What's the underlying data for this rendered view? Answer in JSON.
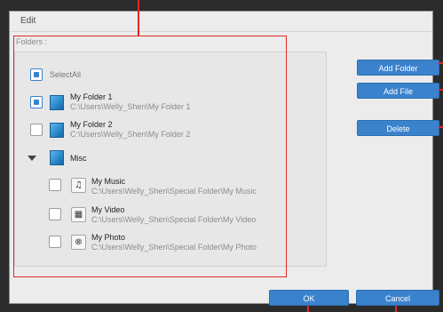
{
  "dialog": {
    "title": "Edit"
  },
  "folders": {
    "label": "Folders :",
    "select_all": {
      "label": "SelectAll",
      "checked": true
    },
    "items": [
      {
        "name": "My Folder 1",
        "path": "C:\\Users\\Welly_Shen\\My Folder 1",
        "checked": true,
        "icon": "folder-icon"
      },
      {
        "name": "My Folder 2",
        "path": "C:\\Users\\Welly_Shen\\My Folder 2",
        "checked": false,
        "icon": "folder-icon"
      }
    ],
    "misc": {
      "name": "Misc",
      "icon": "folder-icon",
      "expanded": true,
      "children": [
        {
          "name": "My Music",
          "path": "C:\\Users\\Welly_Shen\\Special Folder\\My Music",
          "checked": false,
          "icon": "music-icon",
          "glyph": "♫"
        },
        {
          "name": "My Video",
          "path": "C:\\Users\\Welly_Shen\\Special Folder\\My Video",
          "checked": false,
          "icon": "video-icon",
          "glyph": "▦"
        },
        {
          "name": "My Photo",
          "path": "C:\\Users\\Welly_Shen\\Special Folder\\My Photo",
          "checked": false,
          "icon": "photo-icon",
          "glyph": "⊗"
        }
      ]
    }
  },
  "actions": {
    "add_folder": "Add Folder",
    "add_file": "Add File",
    "delete": "Delete"
  },
  "footer": {
    "ok": "OK",
    "cancel": "Cancel"
  },
  "colors": {
    "accent": "#3b82cc",
    "highlight": "#e32626"
  }
}
